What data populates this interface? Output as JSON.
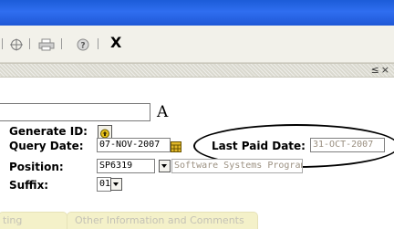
{
  "toolbar": {
    "close_glyph": "X",
    "icons": [
      "globe-icon",
      "print-icon",
      "help-icon",
      "close-icon"
    ]
  },
  "header": {
    "annotation": "A"
  },
  "form": {
    "generate_id": {
      "label": "Generate ID:"
    },
    "query_date": {
      "label": "Query Date:",
      "value": "07-NOV-2007"
    },
    "last_paid_date": {
      "label": "Last Paid Date:",
      "value": "31-OCT-2007"
    },
    "position": {
      "label": "Position:",
      "value": "SP6319",
      "description": "Software Systems Programmer"
    },
    "suffix": {
      "label": "Suffix:",
      "value": "01"
    }
  },
  "tabs": [
    {
      "label": "ting"
    },
    {
      "label": "Other Information and Comments"
    }
  ],
  "colors": {
    "titlebar": "#2f6ef0",
    "tab_background": "#f4f1c9",
    "readonly_text": "#9a8f80"
  }
}
